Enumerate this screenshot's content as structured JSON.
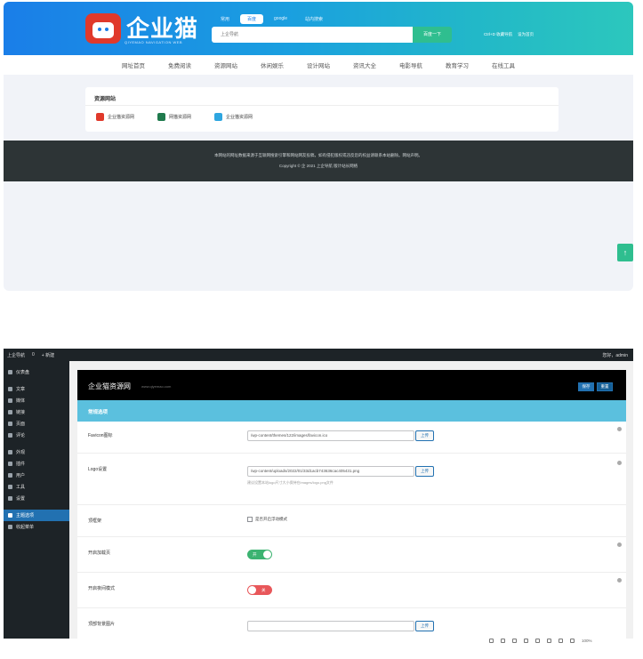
{
  "site": {
    "logo_text": "企业猫",
    "logo_sub": "QIYEMAO NAVIGATION WEB",
    "search_tabs": [
      "常用",
      "百度",
      "google",
      "站内搜索"
    ],
    "active_search_tab": "百度",
    "search_placeholder": "上企导航",
    "search_button": "百度一下",
    "header_links": [
      "Ctrl+D 收藏导航",
      "设为首页"
    ],
    "nav": [
      "网址首页",
      "免费阅读",
      "资源网站",
      "休闲娱乐",
      "设计网站",
      "资讯大全",
      "电影导航",
      "教育学习",
      "在线工具"
    ],
    "resources": {
      "title": "资源网站",
      "links": [
        "企业猫资源网",
        "网猫资源网",
        "企业猫资源网"
      ],
      "icon_colors": [
        "#e0392b",
        "#1f7a4d",
        "#2ea6e0"
      ]
    },
    "footer_line1": "本网站的网址数据来源于互联网搜索引擎和网站网友投稿，如有侵犯版权或违反您的权益请联系本站删除。网站声明。",
    "footer_line2": "Copyright © 企 2021 上企导航 版计站长网络",
    "to_top": "↑"
  },
  "admin": {
    "adminbar_left": [
      "上企导航",
      "0",
      "+ 新建"
    ],
    "adminbar_right": "您好，admin",
    "menu": [
      {
        "label": "仪表盘",
        "active": false
      },
      {
        "label": "文章",
        "active": false
      },
      {
        "label": "媒体",
        "active": false
      },
      {
        "label": "链接",
        "active": false
      },
      {
        "label": "页面",
        "active": false
      },
      {
        "label": "评论",
        "active": false
      },
      {
        "label": "外观",
        "active": false
      },
      {
        "label": "插件",
        "active": false
      },
      {
        "label": "用户",
        "active": false
      },
      {
        "label": "工具",
        "active": false
      },
      {
        "label": "设置",
        "active": false
      },
      {
        "label": "主题选项",
        "active": true
      },
      {
        "label": "收起菜单",
        "active": false
      }
    ],
    "panel_title": "企业猫资源网",
    "panel_sub": "www.qiyemao.com",
    "save_label": "保存",
    "reset_label": "重置",
    "section_title": "常规选项",
    "fields": {
      "favicon_label": "Favicon图标",
      "favicon_value": "/wp-content/themes/122/images/favicon.ico",
      "upload_label": "上传",
      "logo_label": "Logo设置",
      "logo_value": "/wp-content/uploads/2022/01/33d1acb743636cac405431.png",
      "logo_help": "建议设置本站logo尺寸大小保持在images/logo.png文件",
      "frame_label": "顶框架",
      "frame_checkbox": "是否开启浮动模式",
      "preload_label": "开启加载页",
      "preload_state": "开",
      "dark_label": "开启夜间模式",
      "dark_state": "关",
      "banner_label": "顶部背景图片",
      "banner_value": ""
    },
    "tray_text": "100%"
  }
}
